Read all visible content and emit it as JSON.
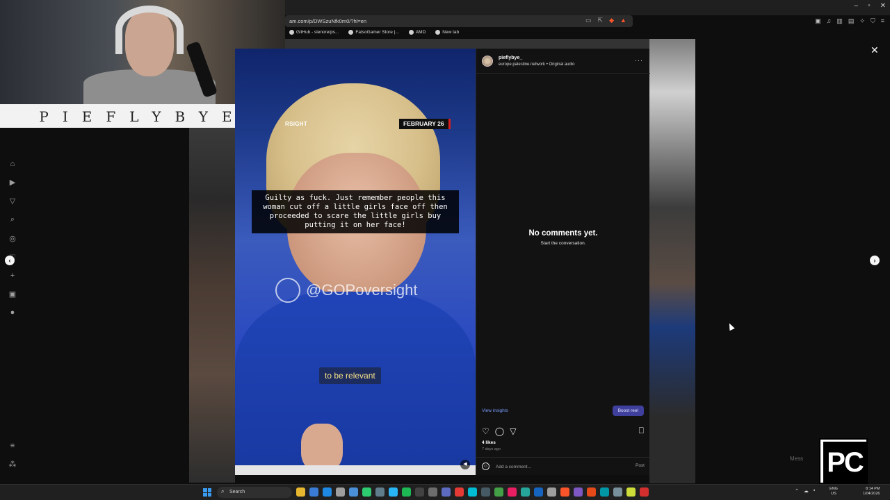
{
  "browser": {
    "url": "am.com/p/DWSzuNfk0m0/?hl=en",
    "bookmarks": [
      "GitHub - slenore/ps...",
      "FatsoGamer Store |...",
      "AMD",
      "New tab"
    ],
    "window_controls": [
      "–",
      "▫",
      "✕"
    ]
  },
  "webcam": {
    "banner_text": "PIEFLYBYE"
  },
  "reel": {
    "source_tag": "RSIGHT",
    "date_tag": "FEBRUARY 26",
    "caption": "Guilty as fuck. Just remember people this woman cut off a little girls face off then proceeded to scare the little girls buy putting it on her face!",
    "watermark": "@GOPoversight",
    "subtitle": "to be relevant"
  },
  "sidebar": {
    "username": "pieflybye_",
    "subline": "europe.palestine.network • Original audio",
    "more_label": "···",
    "empty_title": "No comments yet.",
    "empty_subtitle": "Start the conversation.",
    "insights_label": "View insights",
    "boost_label": "Boost reel",
    "likes": "4 likes",
    "time_ago": "7 days ago",
    "comment_placeholder": "Add a comment...",
    "post_label": "Post"
  },
  "icons": {
    "close": "✕",
    "prev": "‹",
    "next": "›",
    "heart": "♡",
    "comment": "◯",
    "share": "▽",
    "bookmark": "⎕",
    "mute": "◀",
    "emoji": "☺",
    "search": "⌕",
    "left_nav": [
      "⌂",
      "▶",
      "▽",
      "⌕",
      "◎",
      "♡",
      "+",
      "▣",
      "●"
    ],
    "left_nav_bottom": [
      "≡",
      "⁂"
    ]
  },
  "pc_logo": "PC",
  "mess_label": "Mess",
  "taskbar": {
    "search_placeholder": "Search",
    "lang_top": "ENG",
    "lang_bottom": "US",
    "time": "8:14 PM",
    "date": "1/04/2026",
    "app_colors": [
      "#e8b730",
      "#3a7bd5",
      "#1e88e5",
      "#9e9e9e",
      "#4a90d9",
      "#2ecc71",
      "#607d8b",
      "#29b6f6",
      "#1db954",
      "#424242",
      "#6d6d6d",
      "#5c6bc0",
      "#e53935",
      "#00bcd4",
      "#455a64",
      "#43a047",
      "#e91e63",
      "#26a69a",
      "#1565c0",
      "#9e9e9e",
      "#fb542b",
      "#7e57c2",
      "#e64a19",
      "#0097a7",
      "#78909c",
      "#cddc39",
      "#d32f2f"
    ],
    "accent": "#3a9bf0"
  },
  "colors": {
    "reel_blue": "#2140a8",
    "date_red": "#d71d1d",
    "boost": "#3f3f9e",
    "link": "#7a9dff"
  }
}
